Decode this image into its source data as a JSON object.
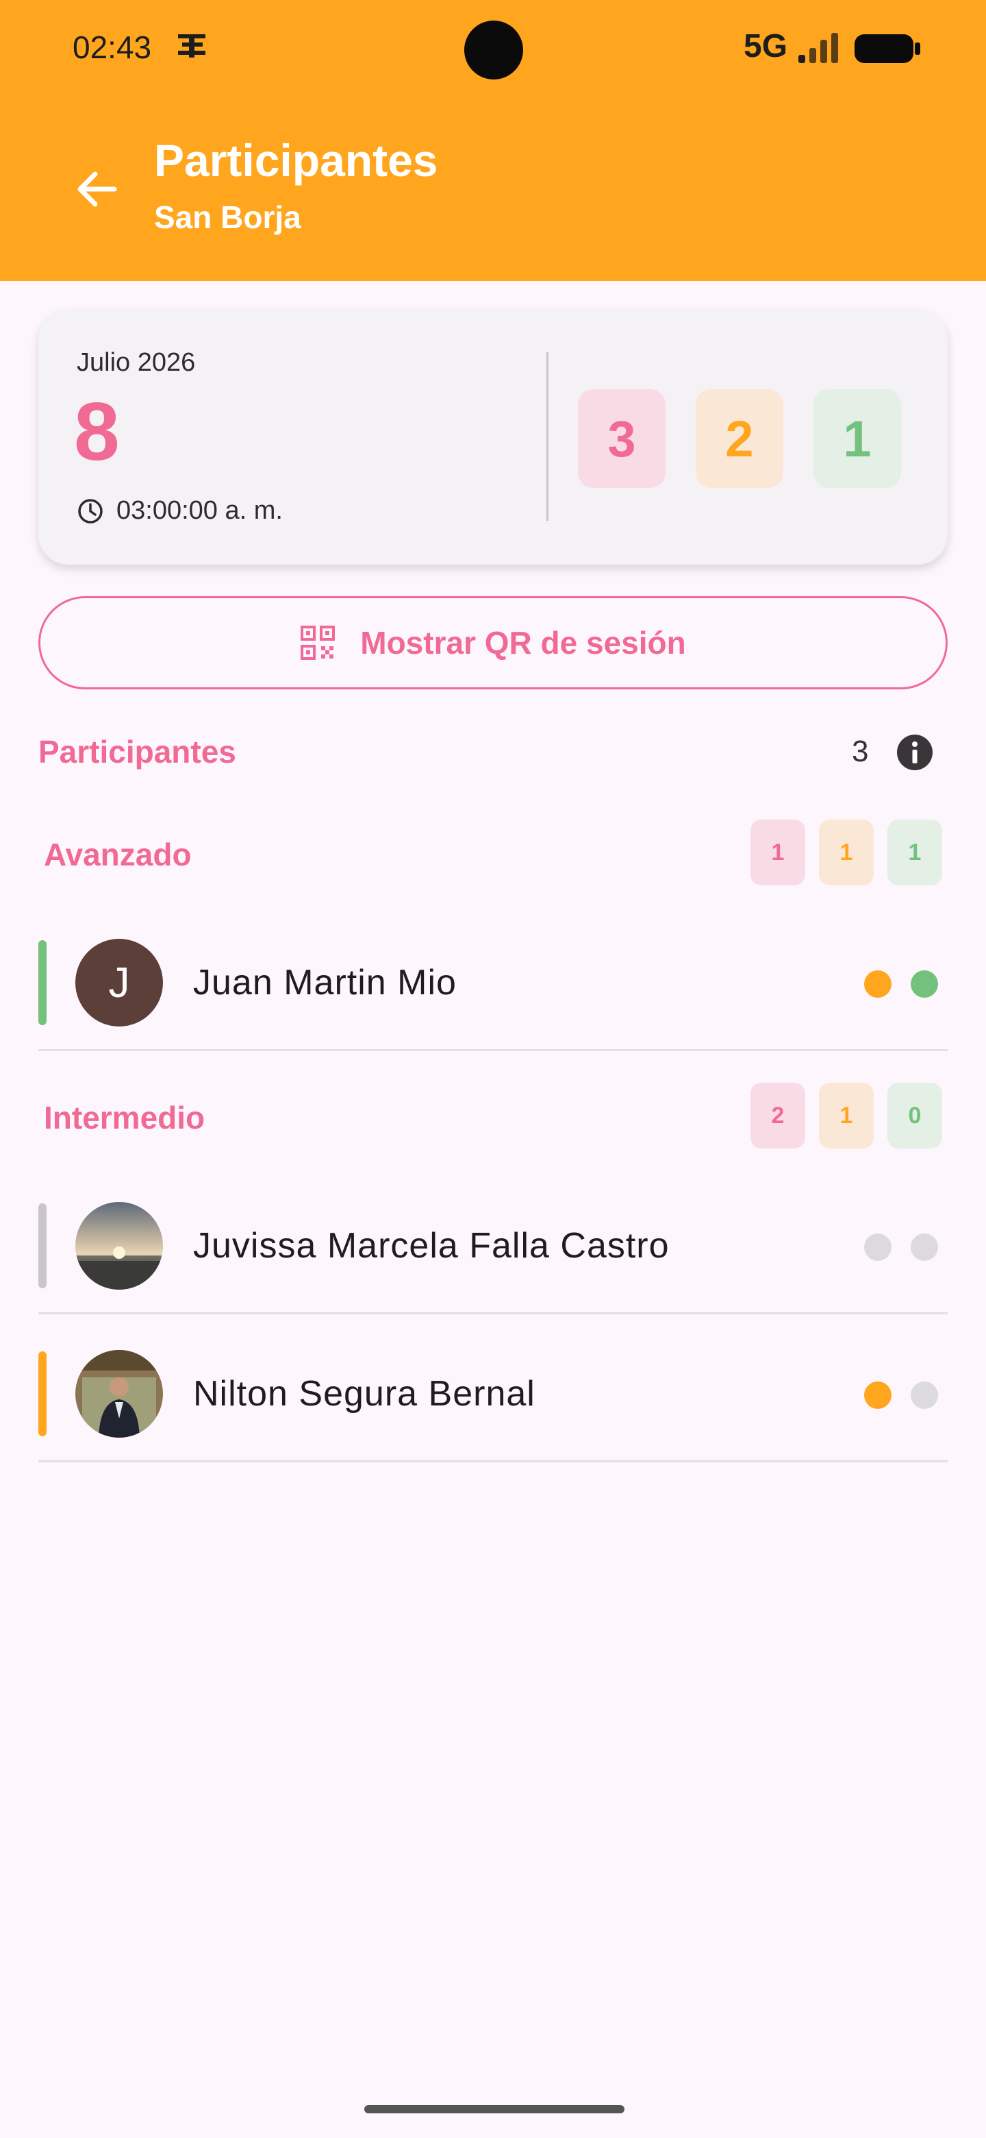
{
  "status_bar": {
    "time": "02:43",
    "network": "5G",
    "icons": [
      "app-notification-icon",
      "signal-icon",
      "battery-icon"
    ]
  },
  "header": {
    "title": "Participantes",
    "subtitle": "San Borja",
    "back_icon": "arrow-left-icon"
  },
  "session": {
    "month": "Julio 2026",
    "day": "8",
    "time": "03:00:00 a. m.",
    "counts": {
      "pink": "3",
      "orange": "2",
      "green": "1"
    }
  },
  "qr_button": {
    "label": "Mostrar QR de sesión",
    "icon": "qr-code-icon"
  },
  "participants": {
    "title": "Participantes",
    "count": "3",
    "groups": [
      {
        "name": "Avanzado",
        "counts": {
          "pink": "1",
          "orange": "1",
          "green": "1"
        },
        "members": [
          {
            "name": "Juan Martin Mio",
            "avatar_letter": "J",
            "bar_color": "#73c17c",
            "dots": [
              "#ffa61e",
              "#73c17c"
            ]
          }
        ]
      },
      {
        "name": "Intermedio",
        "counts": {
          "pink": "2",
          "orange": "1",
          "green": "0"
        },
        "members": [
          {
            "name": "Juvissa Marcela Falla Castro",
            "avatar_letter": "",
            "bar_color": "#c9c6c9",
            "dots": [
              "#dcdadd",
              "#dcdadd"
            ]
          },
          {
            "name": "Nilton Segura Bernal",
            "avatar_letter": "",
            "bar_color": "#ffa61e",
            "dots": [
              "#ffa61e",
              "#dcdadd"
            ]
          }
        ]
      }
    ]
  },
  "colors": {
    "header": "#ffa61e",
    "accent_pink": "#f06a94",
    "accent_orange": "#ffa61e",
    "accent_green": "#73c17c",
    "background": "#fdf7fd"
  }
}
